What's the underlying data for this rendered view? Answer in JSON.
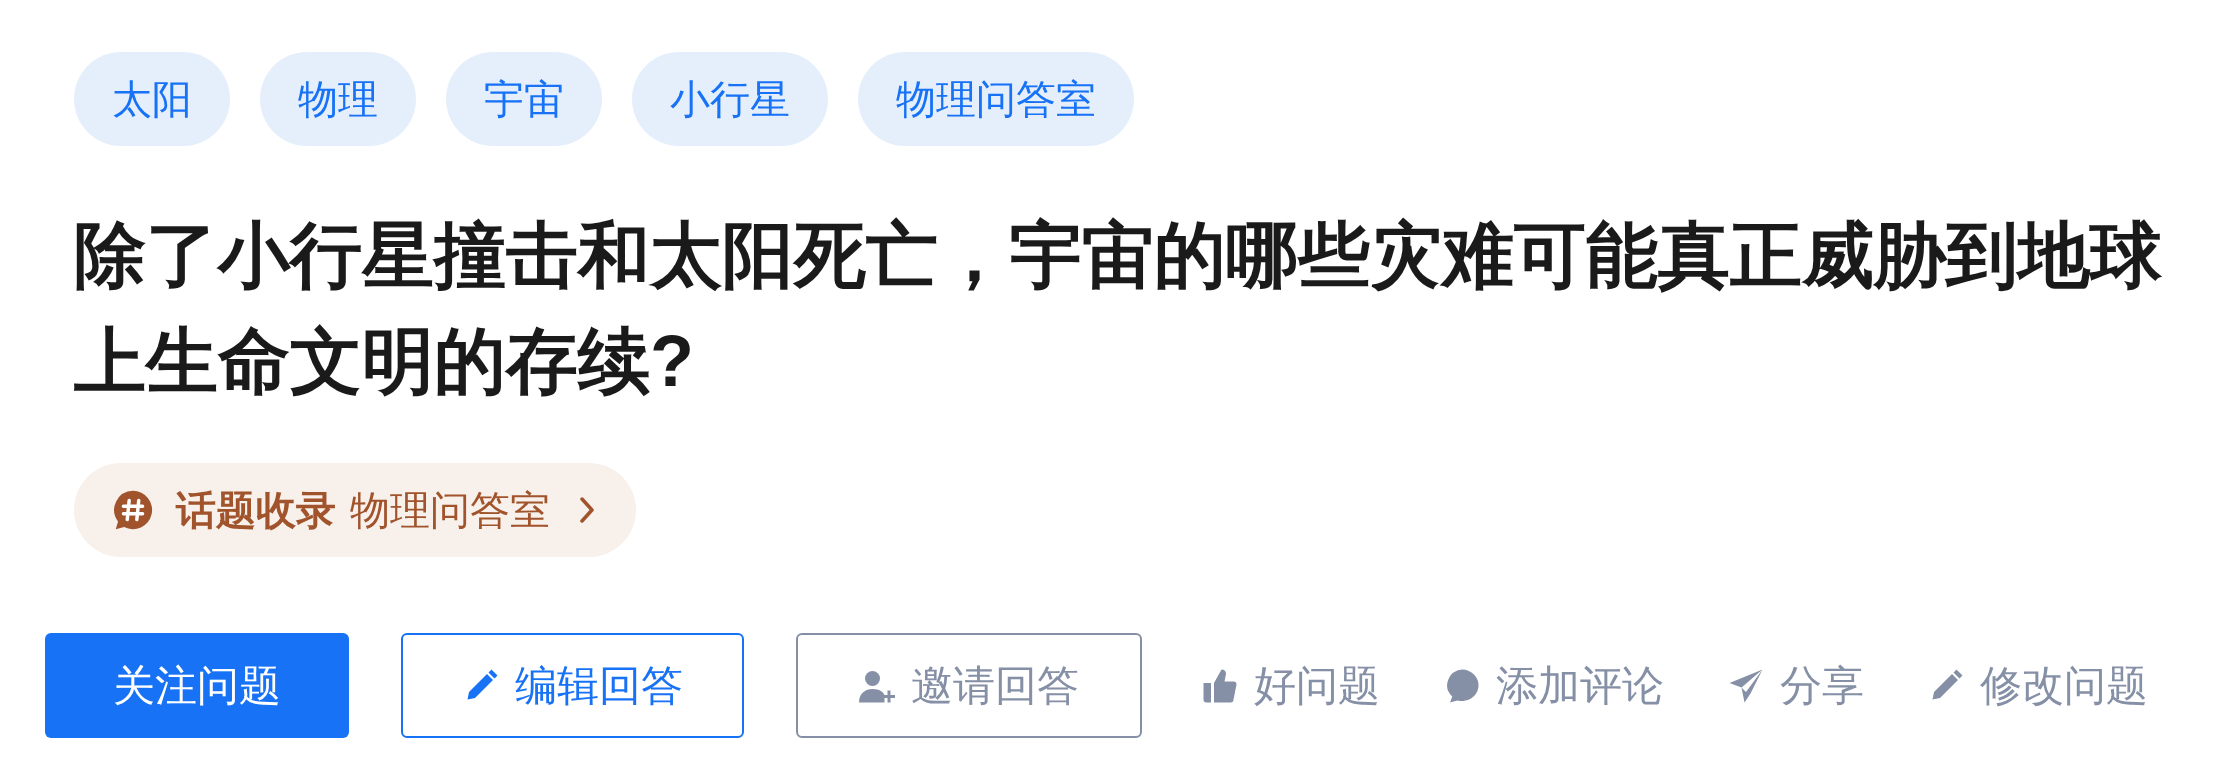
{
  "tags": [
    "太阳",
    "物理",
    "宇宙",
    "小行星",
    "物理问答室"
  ],
  "title": "除了小行星撞击和太阳死亡，宇宙的哪些灾难可能真正威胁到地球上生命文明的存续?",
  "topic_chip": {
    "label": "话题收录",
    "topic": "物理问答室"
  },
  "actions": [
    {
      "kind": "primary",
      "label": "关注问题"
    },
    {
      "kind": "outline_blue",
      "label": "编辑回答"
    },
    {
      "kind": "outline_gray",
      "label": "邀请回答"
    },
    {
      "kind": "plain",
      "label": "好问题"
    },
    {
      "kind": "plain",
      "label": "添加评论"
    },
    {
      "kind": "plain",
      "label": "分享"
    },
    {
      "kind": "plain",
      "label": "修改问题"
    }
  ]
}
